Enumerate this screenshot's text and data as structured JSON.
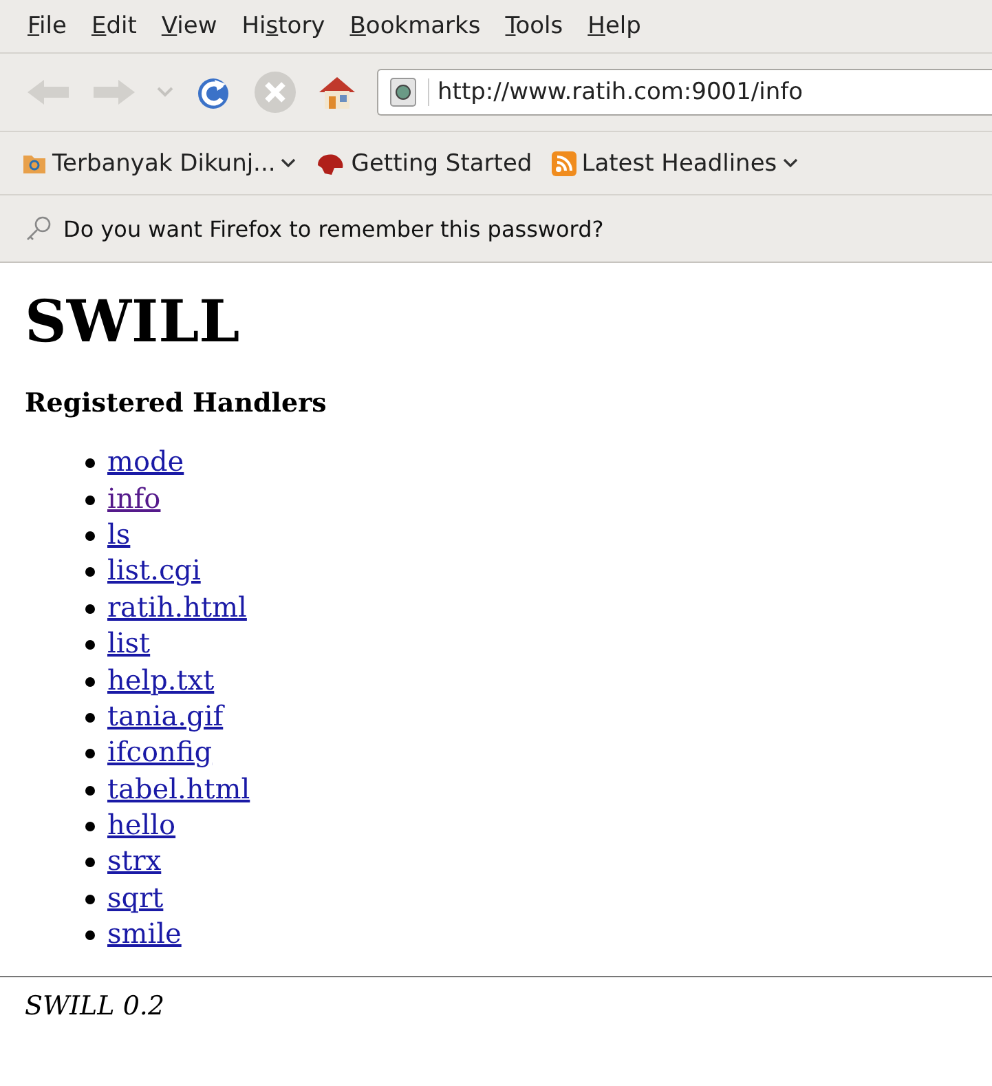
{
  "menu": [
    {
      "parts": [
        {
          "text": "F",
          "underlined": true
        },
        {
          "text": "ile",
          "underlined": false
        }
      ]
    },
    {
      "parts": [
        {
          "text": "E",
          "underlined": true
        },
        {
          "text": "dit",
          "underlined": false
        }
      ]
    },
    {
      "parts": [
        {
          "text": "V",
          "underlined": true
        },
        {
          "text": "iew",
          "underlined": false
        }
      ]
    },
    {
      "parts": [
        {
          "text": "Hi",
          "underlined": false
        },
        {
          "text": "s",
          "underlined": true
        },
        {
          "text": "tory",
          "underlined": false
        }
      ]
    },
    {
      "parts": [
        {
          "text": "B",
          "underlined": true
        },
        {
          "text": "ookmarks",
          "underlined": false
        }
      ]
    },
    {
      "parts": [
        {
          "text": "T",
          "underlined": true
        },
        {
          "text": "ools",
          "underlined": false
        }
      ]
    },
    {
      "parts": [
        {
          "text": "H",
          "underlined": true
        },
        {
          "text": "elp",
          "underlined": false
        }
      ]
    }
  ],
  "toolbar": {
    "back_disabled": true,
    "forward_disabled": true,
    "stop_disabled": true,
    "url": "http://www.ratih.com:9001/info"
  },
  "bookmarks": [
    {
      "kind": "folder",
      "label": "Terbanyak Dikunj...",
      "dropdown": true
    },
    {
      "kind": "page",
      "label": "Getting Started",
      "dropdown": false
    },
    {
      "kind": "feed",
      "label": "Latest Headlines",
      "dropdown": true
    }
  ],
  "notification": {
    "text": "Do you want Firefox to remember this password?"
  },
  "page": {
    "title": "SWILL",
    "heading": "Registered Handlers",
    "links": [
      {
        "text": "mode",
        "visited": false
      },
      {
        "text": "info",
        "visited": true
      },
      {
        "text": "ls",
        "visited": false
      },
      {
        "text": "list.cgi",
        "visited": false
      },
      {
        "text": "ratih.html",
        "visited": false
      },
      {
        "text": "list",
        "visited": false
      },
      {
        "text": "help.txt",
        "visited": false
      },
      {
        "text": "tania.gif",
        "visited": false
      },
      {
        "text": "ifconfig",
        "visited": false
      },
      {
        "text": "tabel.html",
        "visited": false
      },
      {
        "text": "hello",
        "visited": false
      },
      {
        "text": "strx",
        "visited": false
      },
      {
        "text": "sqrt",
        "visited": false
      },
      {
        "text": "smile",
        "visited": false
      }
    ],
    "footer": "SWILL 0.2"
  }
}
